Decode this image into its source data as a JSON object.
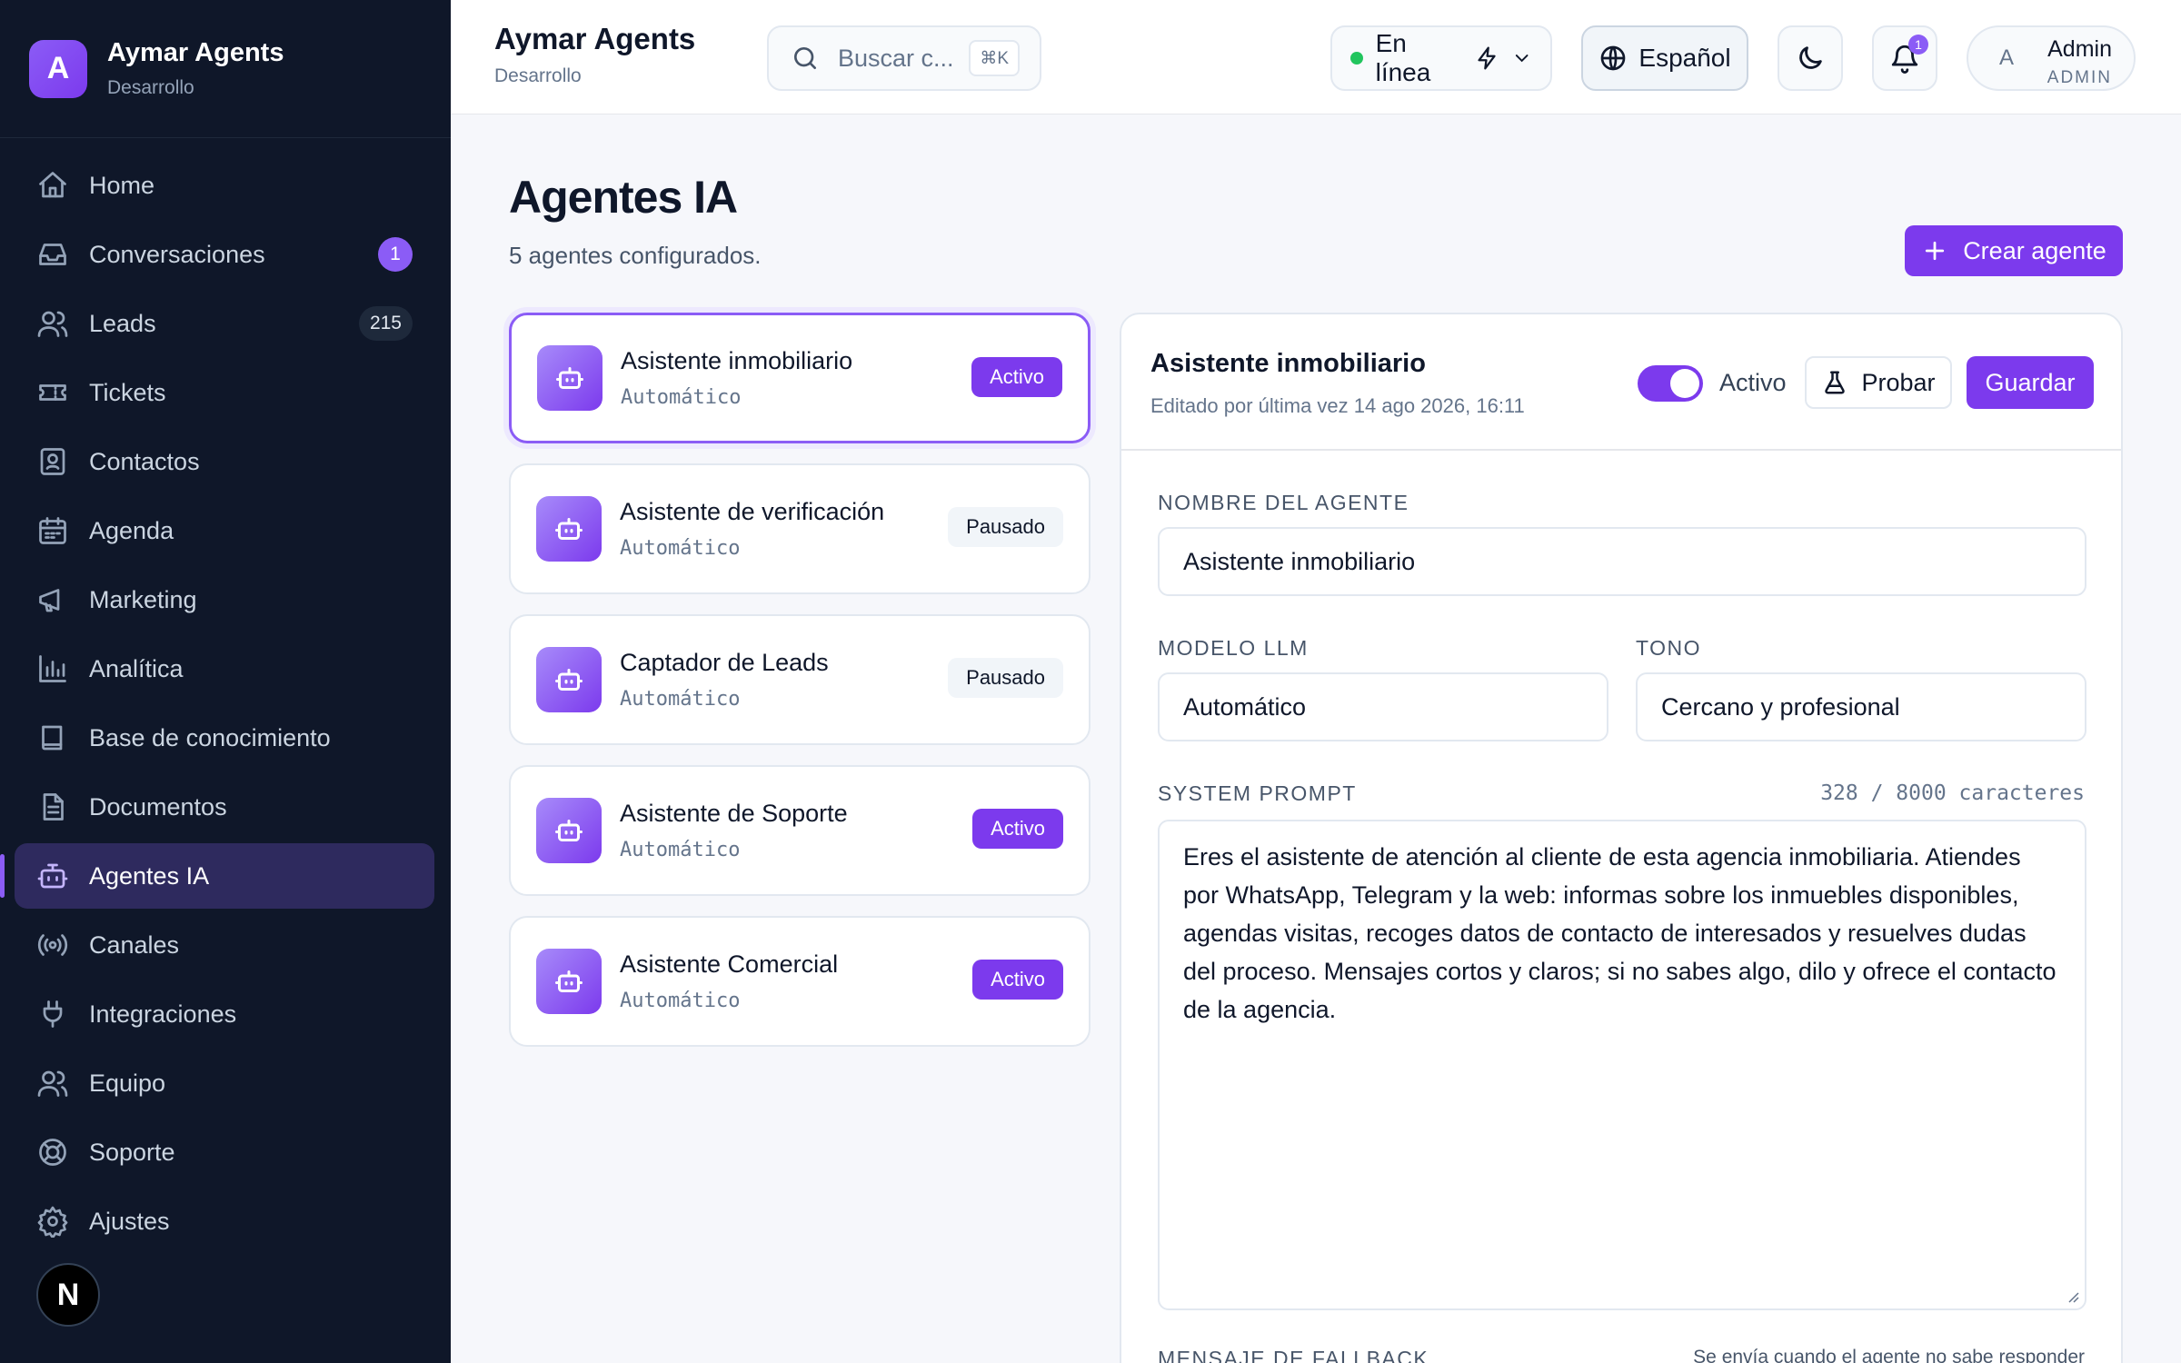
{
  "brand": {
    "logo_letter": "A",
    "title": "Aymar Agents",
    "subtitle": "Desarrollo"
  },
  "sidebar": {
    "items": [
      {
        "label": "Home",
        "icon": "home-icon"
      },
      {
        "label": "Conversaciones",
        "icon": "inbox-icon",
        "badge": "1"
      },
      {
        "label": "Leads",
        "icon": "users-icon",
        "badge": "215"
      },
      {
        "label": "Tickets",
        "icon": "ticket-icon"
      },
      {
        "label": "Contactos",
        "icon": "contact-icon"
      },
      {
        "label": "Agenda",
        "icon": "calendar-icon"
      },
      {
        "label": "Marketing",
        "icon": "megaphone-icon"
      },
      {
        "label": "Analítica",
        "icon": "bar-chart-icon"
      },
      {
        "label": "Base de conocimiento",
        "icon": "book-icon"
      },
      {
        "label": "Documentos",
        "icon": "document-icon"
      },
      {
        "label": "Agentes IA",
        "icon": "bot-icon",
        "active": true
      },
      {
        "label": "Canales",
        "icon": "broadcast-icon"
      },
      {
        "label": "Integraciones",
        "icon": "plug-icon"
      },
      {
        "label": "Equipo",
        "icon": "team-icon"
      },
      {
        "label": "Soporte",
        "icon": "lifebuoy-icon"
      },
      {
        "label": "Ajustes",
        "icon": "gear-icon"
      }
    ],
    "footer_logo": "N"
  },
  "header": {
    "title": "Aymar Agents",
    "subtitle": "Desarrollo",
    "search": {
      "placeholder": "Buscar c...",
      "shortcut": "⌘K"
    },
    "status": "En línea",
    "language": "Español",
    "notifications_count": "1",
    "user": {
      "avatar": "A",
      "name": "Admin",
      "role": "ADMIN"
    }
  },
  "page": {
    "title": "Agentes IA",
    "subtitle": "5 agentes configurados.",
    "create_button": "Crear agente"
  },
  "agents": [
    {
      "name": "Asistente inmobiliario",
      "type": "Automático",
      "status": "Activo",
      "selected": true
    },
    {
      "name": "Asistente de verificación",
      "type": "Automático",
      "status": "Pausado"
    },
    {
      "name": "Captador de Leads",
      "type": "Automático",
      "status": "Pausado"
    },
    {
      "name": "Asistente de Soporte",
      "type": "Automático",
      "status": "Activo"
    },
    {
      "name": "Asistente Comercial",
      "type": "Automático",
      "status": "Activo"
    }
  ],
  "detail": {
    "title": "Asistente inmobiliario",
    "edited": "Editado por última vez 14 ago 2026, 16:11",
    "toggle_label": "Activo",
    "toggle_on": true,
    "test_button": "Probar",
    "save_button": "Guardar",
    "name_label": "NOMBRE DEL AGENTE",
    "name_value": "Asistente inmobiliario",
    "model_label": "MODELO LLM",
    "model_value": "Automático",
    "tone_label": "TONO",
    "tone_value": "Cercano y profesional",
    "prompt_label": "SYSTEM PROMPT",
    "prompt_counter": "328 / 8000 caracteres",
    "prompt_value": "Eres el asistente de atención al cliente de esta agencia inmobiliaria. Atiendes por WhatsApp, Telegram y la web: informas sobre los inmuebles disponibles, agendas visitas, recoges datos de contacto de interesados y resuelves dudas del proceso. Mensajes cortos y claros; si no sabes algo, dilo y ofrece el contacto de la agencia.",
    "fallback_label": "MENSAJE DE FALLBACK",
    "fallback_hint": "Se envía cuando el agente no sabe responder"
  },
  "colors": {
    "accent": "#7c3aed",
    "sidebar_bg": "#0f1729",
    "online": "#22c55e"
  }
}
